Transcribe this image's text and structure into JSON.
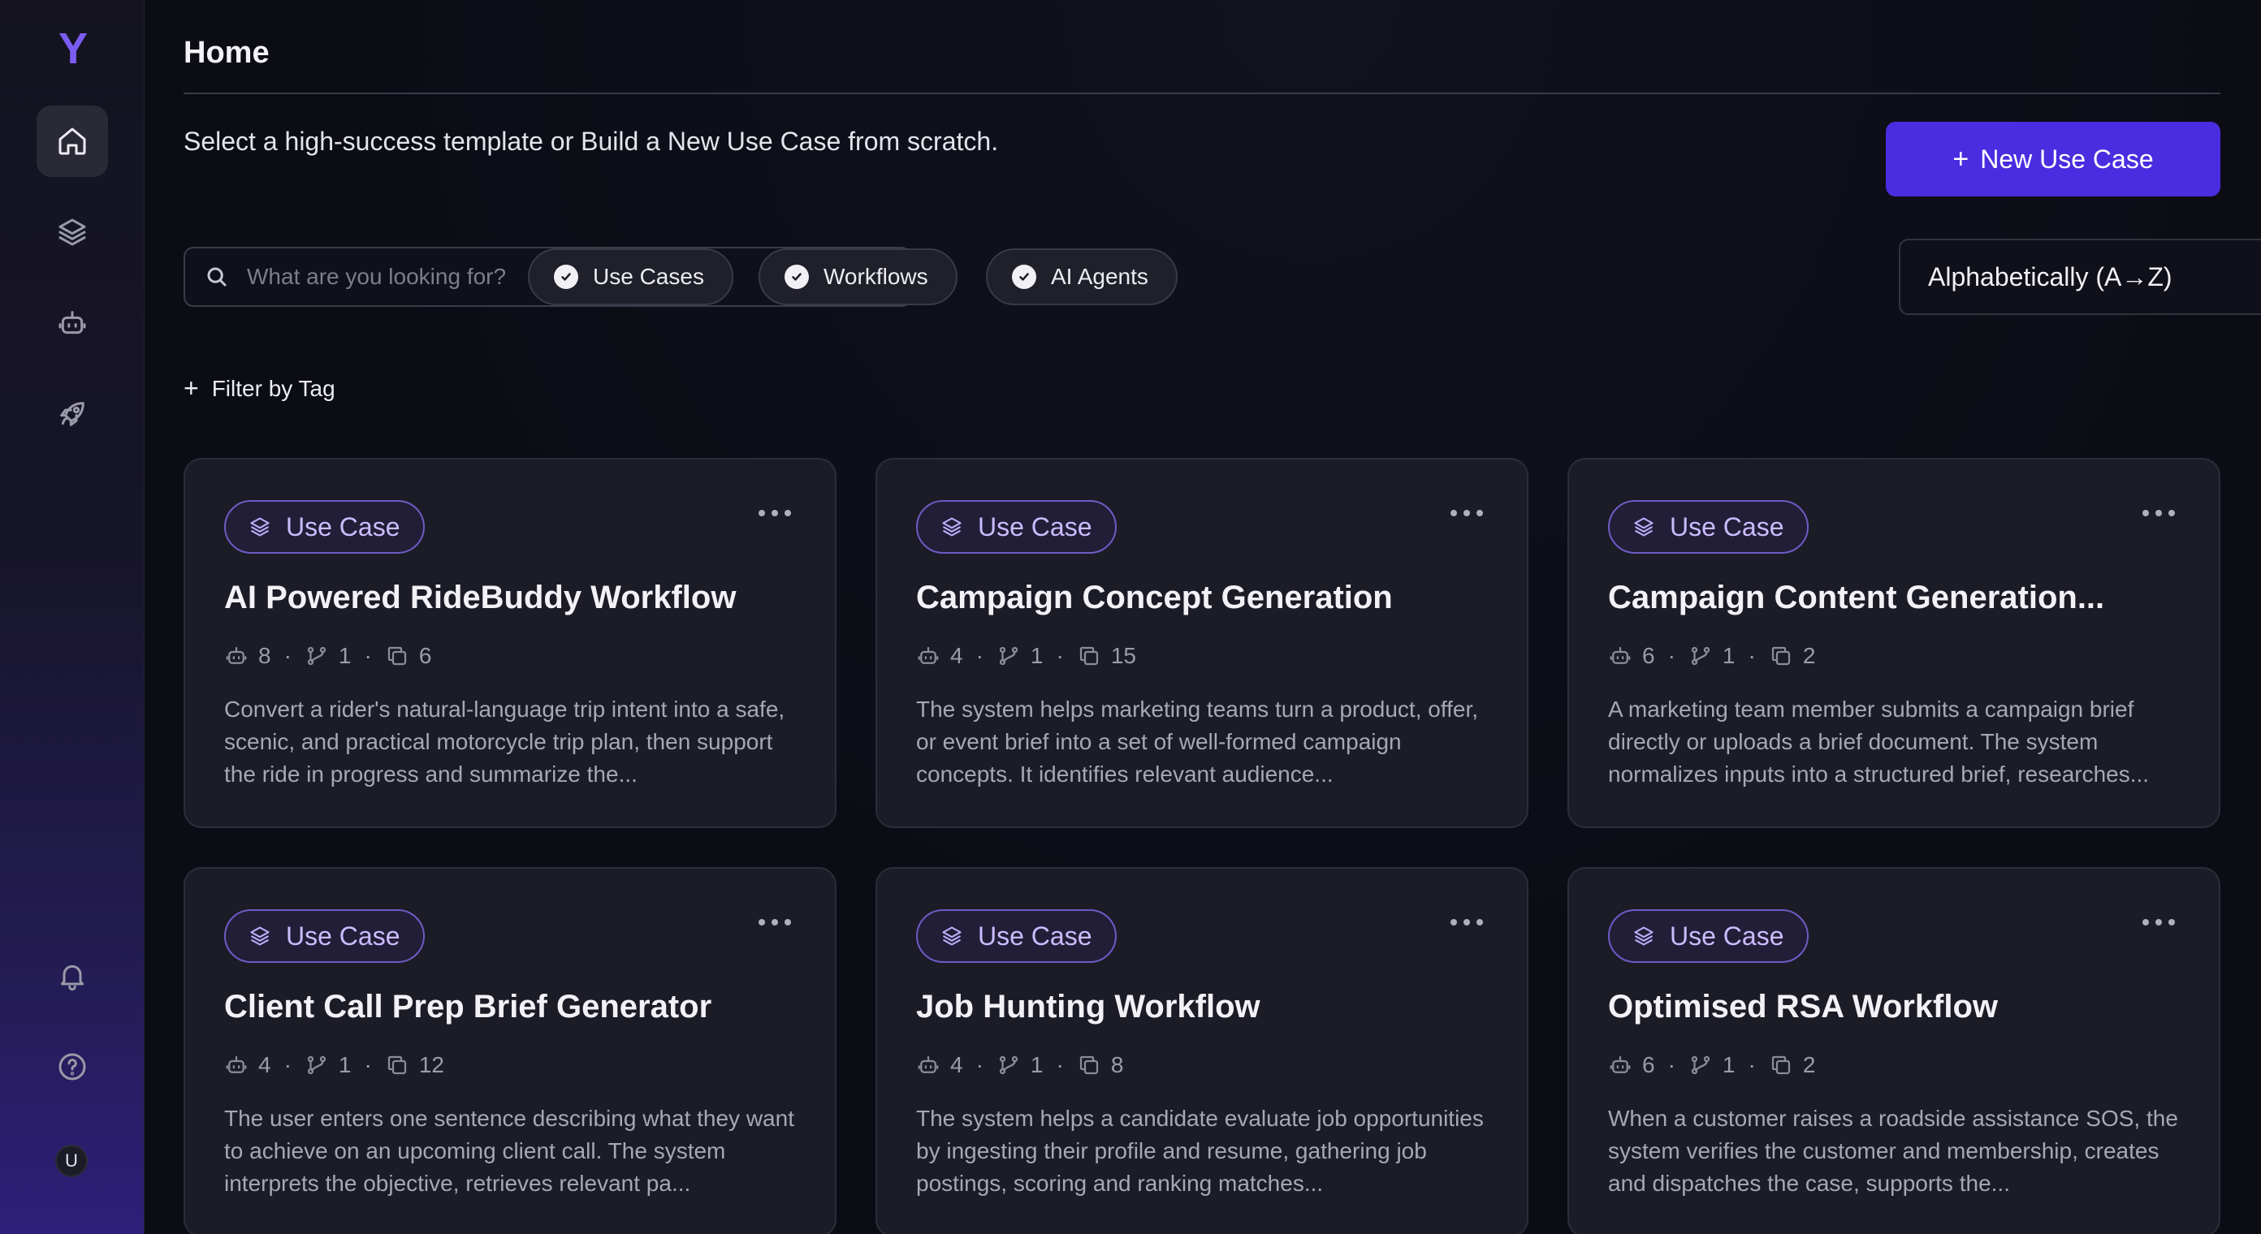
{
  "sidebar": {
    "logo": "Y",
    "avatar": "U"
  },
  "header": {
    "title": "Home",
    "subtitle": "Select a high-success template or Build a New Use Case from scratch.",
    "new_button": "New Use Case"
  },
  "search": {
    "placeholder": "What are you looking for?"
  },
  "filters": {
    "chips": [
      "Use Cases",
      "Workflows",
      "AI Agents"
    ],
    "sort": "Alphabetically (A→Z)",
    "filter_by_tag": "Filter by Tag"
  },
  "cards": [
    {
      "tag": "Use Case",
      "title": "AI Powered RideBuddy Workflow",
      "agents": "8",
      "branches": "1",
      "copies": "6",
      "description": "Convert a rider's natural-language trip intent into a safe, scenic, and practical motorcycle trip plan, then support the ride in progress and summarize the..."
    },
    {
      "tag": "Use Case",
      "title": "Campaign Concept Generation",
      "agents": "4",
      "branches": "1",
      "copies": "15",
      "description": "The system helps marketing teams turn a product, offer, or event brief into a set of well-formed campaign concepts. It identifies relevant audience..."
    },
    {
      "tag": "Use Case",
      "title": "Campaign Content Generation...",
      "agents": "6",
      "branches": "1",
      "copies": "2",
      "description": "A marketing team member submits a campaign brief directly or uploads a brief document. The system normalizes inputs into a structured brief, researches..."
    },
    {
      "tag": "Use Case",
      "title": "Client Call Prep Brief Generator",
      "agents": "4",
      "branches": "1",
      "copies": "12",
      "description": "The user enters one sentence describing what they want to achieve on an upcoming client call. The system interprets the objective, retrieves relevant pa..."
    },
    {
      "tag": "Use Case",
      "title": "Job Hunting Workflow",
      "agents": "4",
      "branches": "1",
      "copies": "8",
      "description": "The system helps a candidate evaluate job opportunities by ingesting their profile and resume, gathering job postings, scoring and ranking matches..."
    },
    {
      "tag": "Use Case",
      "title": "Optimised RSA Workflow",
      "agents": "6",
      "branches": "1",
      "copies": "2",
      "description": "When a customer raises a roadside assistance SOS, the system verifies the customer and membership, creates and dispatches the case, supports the..."
    }
  ],
  "colors": {
    "accent": "#4a2de0",
    "logo": "#7b5cf0",
    "tag_border": "#6d5cc4",
    "tag_text": "#cbbcff"
  }
}
